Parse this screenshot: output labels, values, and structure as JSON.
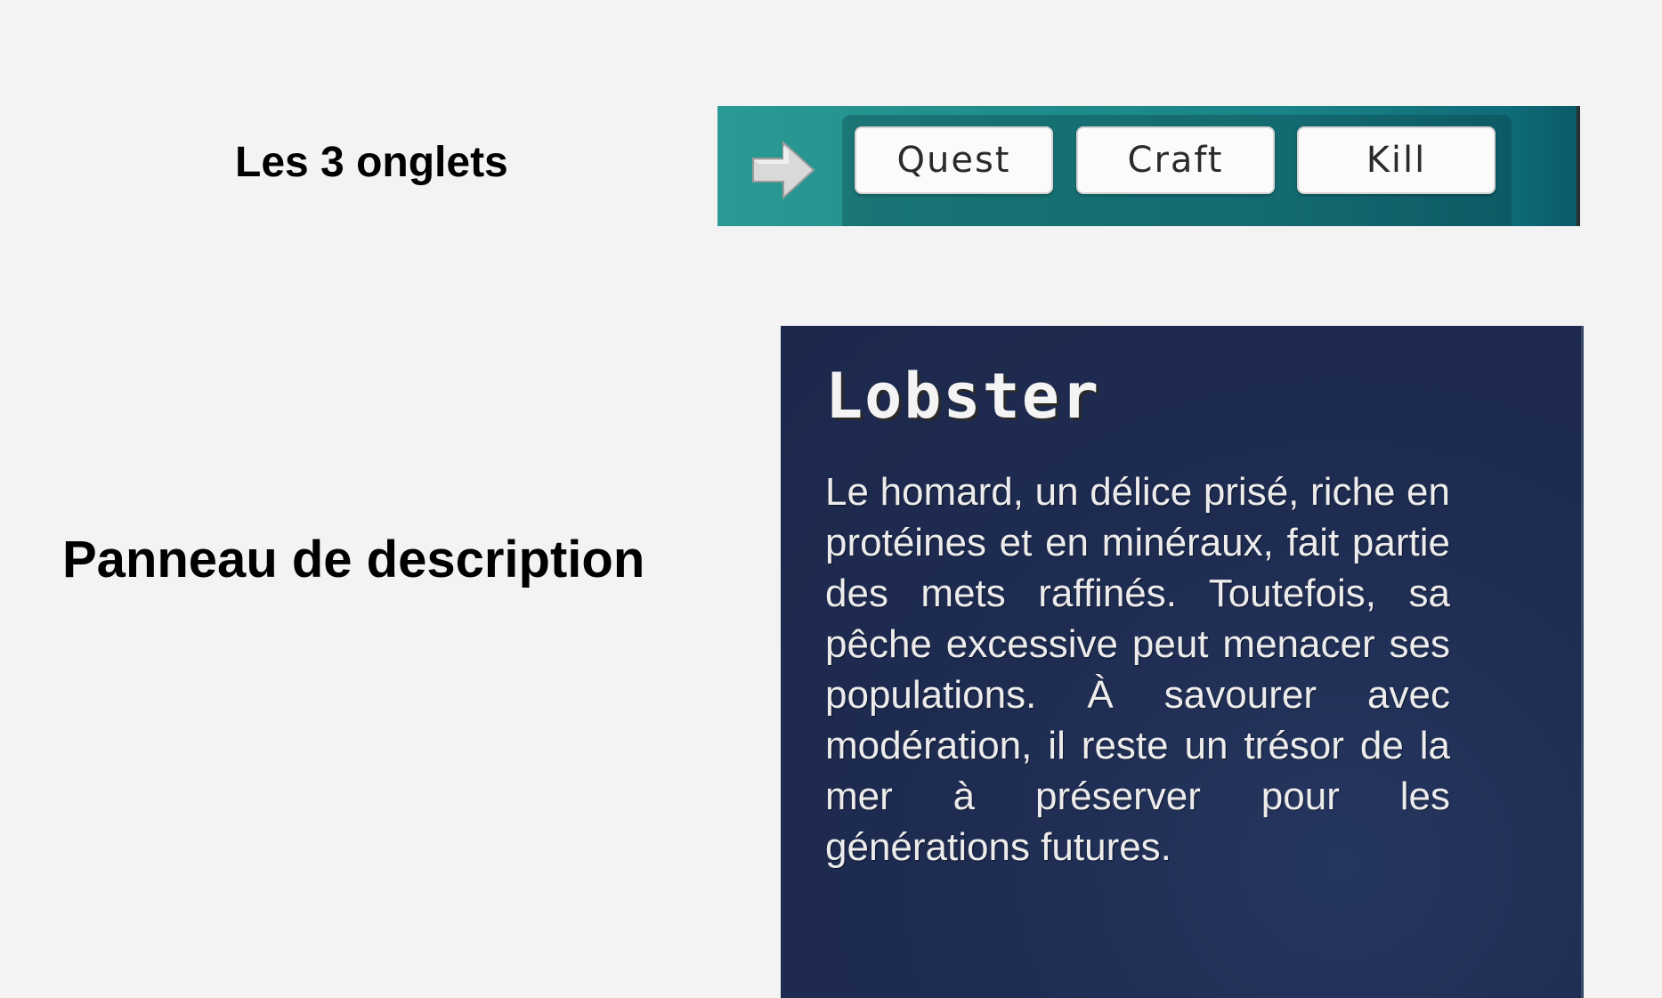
{
  "captions": {
    "tabs": "Les 3 onglets",
    "panel": "Panneau de description"
  },
  "tab_bar": {
    "icon": "arrow-right-icon",
    "tabs": [
      {
        "label": "Quest"
      },
      {
        "label": "Craft"
      },
      {
        "label": "Kill"
      }
    ],
    "colors": {
      "bar": "#1f8d8c",
      "button": "#fbfbfb",
      "button_text": "#2b2b2b"
    }
  },
  "description_panel": {
    "title": "Lobster",
    "body": "Le homard, un délice prisé, riche en protéines et en minéraux, fait partie des mets raffinés. Toutefois, sa pêche excessive peut menacer ses populations. À savourer avec modération, il reste un trésor de la mer à préserver pour les générations futures.",
    "colors": {
      "background": "#1f2c52",
      "text": "#ececec"
    }
  }
}
